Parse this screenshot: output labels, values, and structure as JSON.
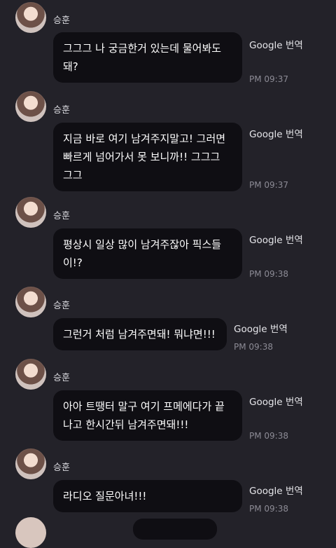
{
  "messages": [
    {
      "sender": "승훈",
      "text": "그그그 나 궁금한거 있는데 물어봐도 돼?",
      "translate": "Google 번역",
      "time": "PM 09:37"
    },
    {
      "sender": "승훈",
      "text": "지금 바로 여기 남겨주지말고! 그러면 빠르게 넘어가서 못 보니까!! 그그그 그그",
      "translate": "Google 번역",
      "time": "PM 09:37"
    },
    {
      "sender": "승훈",
      "text": "평상시 일상 많이 남겨주잖아 픽스들이!?",
      "translate": "Google 번역",
      "time": "PM 09:38"
    },
    {
      "sender": "승훈",
      "text": "그런거 처럼 남겨주면돼! 뭐냐면!!!",
      "translate": "Google 번역",
      "time": "PM 09:38"
    },
    {
      "sender": "승훈",
      "text": "아아 트땡터 말구 여기 프메에다가 끝나고 한시간뒤 남겨주면돼!!!",
      "translate": "Google 번역",
      "time": "PM 09:38"
    },
    {
      "sender": "승훈",
      "text": "라디오 질문아녀!!!",
      "translate": "Google 번역",
      "time": "PM 09:38"
    }
  ]
}
